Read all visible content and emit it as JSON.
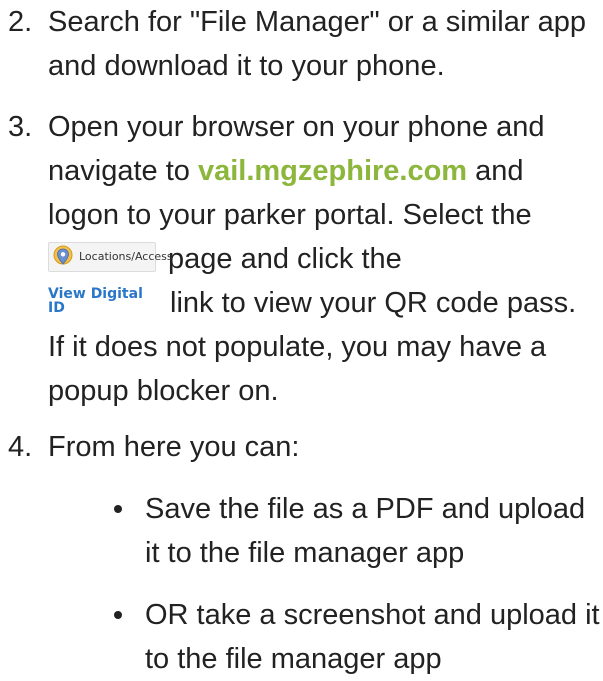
{
  "steps": [
    {
      "number": "2.",
      "text": "Search for \"File Manager\" or a similar app and download it to your phone."
    },
    {
      "number": "3.",
      "text_before_link": "Open your browser on your phone and navigate to ",
      "link_text": "vail.mgzephire.com",
      "text_after_link": " and logon to your parker portal.  Select the",
      "locations_chip_label": "Locations/Access",
      "locations_chip_icon": "map-pin-icon",
      "text_after_chip": "page and click the",
      "digital_id_label": "View Digital ID",
      "text_after_digital": "link to view your QR code pass.  If it does not populate, you may have a popup blocker on."
    },
    {
      "number": "4.",
      "text": "From here you can:"
    }
  ],
  "bullets": [
    "Save the file as a PDF and upload it to the file manager app",
    "OR take a screenshot and upload it to the file manager app"
  ],
  "colors": {
    "link_green": "#8cb63c",
    "digital_id_blue": "#2a77c9",
    "text": "#222222"
  }
}
